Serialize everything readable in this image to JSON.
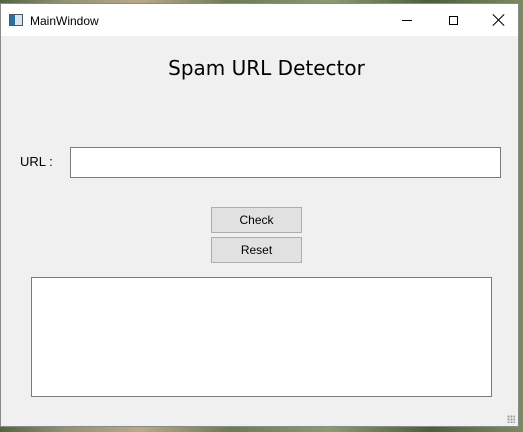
{
  "window": {
    "title": "MainWindow",
    "controls": {
      "minimize": "minimize-icon",
      "maximize": "maximize-icon",
      "close": "close-icon"
    }
  },
  "main": {
    "heading": "Spam URL Detector",
    "url_label": "URL :",
    "url_input": {
      "value": "",
      "placeholder": ""
    },
    "check_label": "Check",
    "reset_label": "Reset",
    "result_text": ""
  },
  "colors": {
    "window_bg": "#f0f0f0",
    "titlebar_bg": "#ffffff",
    "button_bg": "#e1e1e1",
    "field_border": "#7a7a7a"
  }
}
